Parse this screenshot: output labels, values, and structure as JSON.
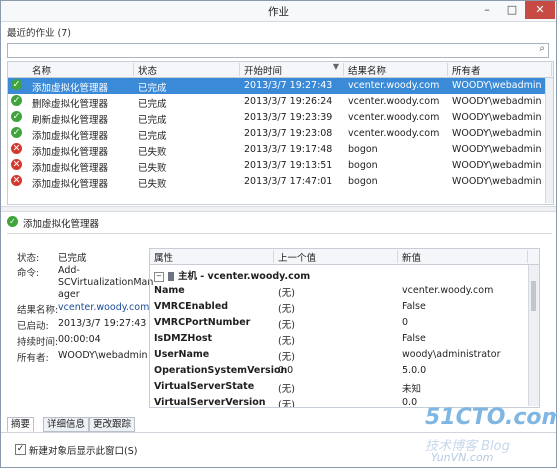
{
  "window": {
    "title": "作业",
    "min_icon": "minimize-icon",
    "max_icon": "maximize-icon",
    "close_icon": "close-icon"
  },
  "recent": {
    "label": "最近的作业 (7)"
  },
  "search": {
    "value": "",
    "icon": "search-icon"
  },
  "list": {
    "columns": [
      "名称",
      "状态",
      "开始时间",
      "结果名称",
      "所有者"
    ],
    "rows": [
      {
        "status_icon": "success-icon",
        "name": "添加虚拟化管理器",
        "state": "已完成",
        "start": "2013/3/7 19:27:43",
        "result": "vcenter.woody.com",
        "owner": "WOODY\\webadmin",
        "selected": true
      },
      {
        "status_icon": "success-icon",
        "name": "删除虚拟化管理器",
        "state": "已完成",
        "start": "2013/3/7 19:26:24",
        "result": "vcenter.woody.com",
        "owner": "WOODY\\webadmin"
      },
      {
        "status_icon": "success-icon",
        "name": "刷新虚拟化管理器",
        "state": "已完成",
        "start": "2013/3/7 19:23:39",
        "result": "vcenter.woody.com",
        "owner": "WOODY\\webadmin"
      },
      {
        "status_icon": "success-icon",
        "name": "添加虚拟化管理器",
        "state": "已完成",
        "start": "2013/3/7 19:23:08",
        "result": "vcenter.woody.com",
        "owner": "WOODY\\webadmin"
      },
      {
        "status_icon": "error-icon",
        "name": "添加虚拟化管理器",
        "state": "已失败",
        "start": "2013/3/7 19:17:48",
        "result": "bogon",
        "owner": "WOODY\\webadmin"
      },
      {
        "status_icon": "error-icon",
        "name": "添加虚拟化管理器",
        "state": "已失败",
        "start": "2013/3/7 19:13:51",
        "result": "bogon",
        "owner": "WOODY\\webadmin"
      },
      {
        "status_icon": "error-icon",
        "name": "添加虚拟化管理器",
        "state": "已失败",
        "start": "2013/3/7 17:47:01",
        "result": "bogon",
        "owner": "WOODY\\webadmin"
      }
    ]
  },
  "detail": {
    "title": "添加虚拟化管理器",
    "status_label": "状态:",
    "status_value": "已完成",
    "command_label": "命令:",
    "command_value_1": "Add-",
    "command_value_2": "SCVirtualizationMan",
    "command_value_3": "ager",
    "result_label": "结果名称:",
    "result_value": "vcenter.woody.com",
    "started_label": "已启动:",
    "started_value": "2013/3/7 19:27:43",
    "duration_label": "持续时间:",
    "duration_value": "00:00:04",
    "owner_label": "所有者:",
    "owner_value": "WOODY\\webadmin"
  },
  "props": {
    "columns": [
      "属性",
      "上一个值",
      "新值"
    ],
    "group": "主机 - vcenter.woody.com",
    "rows": [
      {
        "name": "Name",
        "prev": "(无)",
        "new": "vcenter.woody.com"
      },
      {
        "name": "VMRCEnabled",
        "prev": "(无)",
        "new": "False"
      },
      {
        "name": "VMRCPortNumber",
        "prev": "(无)",
        "new": "0"
      },
      {
        "name": "IsDMZHost",
        "prev": "(无)",
        "new": "False"
      },
      {
        "name": "UserName",
        "prev": "(无)",
        "new": "woody\\administrator"
      },
      {
        "name": "OperationSystemVersion",
        "prev": "0.0",
        "new": "5.0.0"
      },
      {
        "name": "VirtualServerState",
        "prev": "(无)",
        "new": "未知"
      },
      {
        "name": "VirtualServerVersion",
        "prev": "(无)",
        "new": "0.0"
      }
    ]
  },
  "tabs": [
    "摘要",
    "详细信息",
    "更改跟踪"
  ],
  "footer": {
    "checkbox_label": "新建对象后显示此窗口(S)",
    "checked": true
  },
  "watermark": {
    "line1": "51CTO.com",
    "line2": "技术博客 Blog",
    "line3": "YunVN.com"
  }
}
